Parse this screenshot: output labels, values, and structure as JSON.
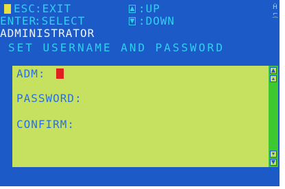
{
  "header": {
    "esc_key": "ESC",
    "esc_action": ":EXIT",
    "up_action": ":UP",
    "enter_key": "ENTER",
    "enter_action": ":SELECT",
    "down_action": ":DOWN",
    "up_icon": "up-arrow-key-icon",
    "down_icon": "down-arrow-key-icon"
  },
  "menu_title": "ADMINISTRATOR",
  "subtitle": "SET USERNAME AND PASSWORD",
  "form": {
    "username_label": "ADM:",
    "password_label": "PASSWORD:",
    "confirm_label": "CONFIRM:"
  },
  "colors": {
    "screen_bg": "#1c5ac8",
    "header_text": "#2fd0f0",
    "panel_bg": "#c6e060",
    "field_text": "#2a70e0",
    "scrollbar": "#3ec830",
    "caret": "#e0201c"
  }
}
